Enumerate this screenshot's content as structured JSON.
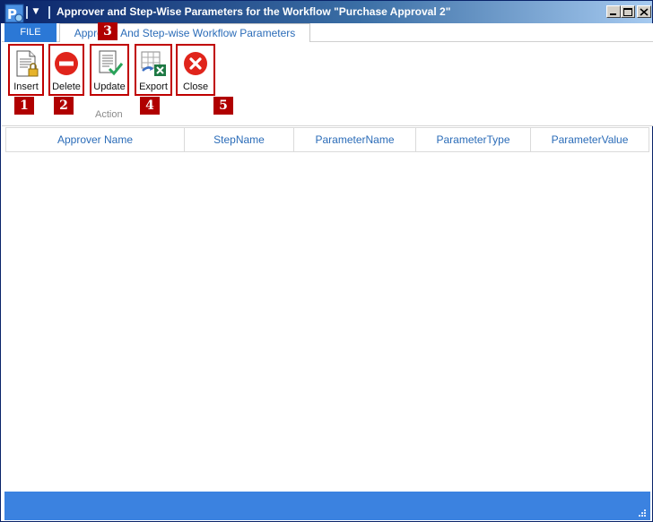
{
  "window": {
    "title": "Approver and Step-Wise Parameters for the Workflow \"Purchase Approval 2\""
  },
  "tabs": {
    "file": "FILE",
    "ribbon_tab": "Approver And Step-wise Workflow Parameters"
  },
  "ribbon": {
    "group_label": "Action",
    "buttons": [
      {
        "label": "Insert",
        "icon": "insert-document-lock-icon",
        "callout": "1"
      },
      {
        "label": "Delete",
        "icon": "delete-minus-icon",
        "callout": "2"
      },
      {
        "label": "Update",
        "icon": "update-check-icon",
        "callout": "3"
      },
      {
        "label": "Export",
        "icon": "export-excel-icon",
        "callout": "4"
      },
      {
        "label": "Close",
        "icon": "close-x-icon",
        "callout": "5"
      }
    ]
  },
  "grid": {
    "columns": [
      "Approver Name",
      "StepName",
      "ParameterName",
      "ParameterType",
      "ParameterValue"
    ],
    "rows": []
  },
  "colors": {
    "accent_blue": "#2b78d6",
    "callout_red": "#b00000",
    "status_bar": "#3b82e0"
  }
}
